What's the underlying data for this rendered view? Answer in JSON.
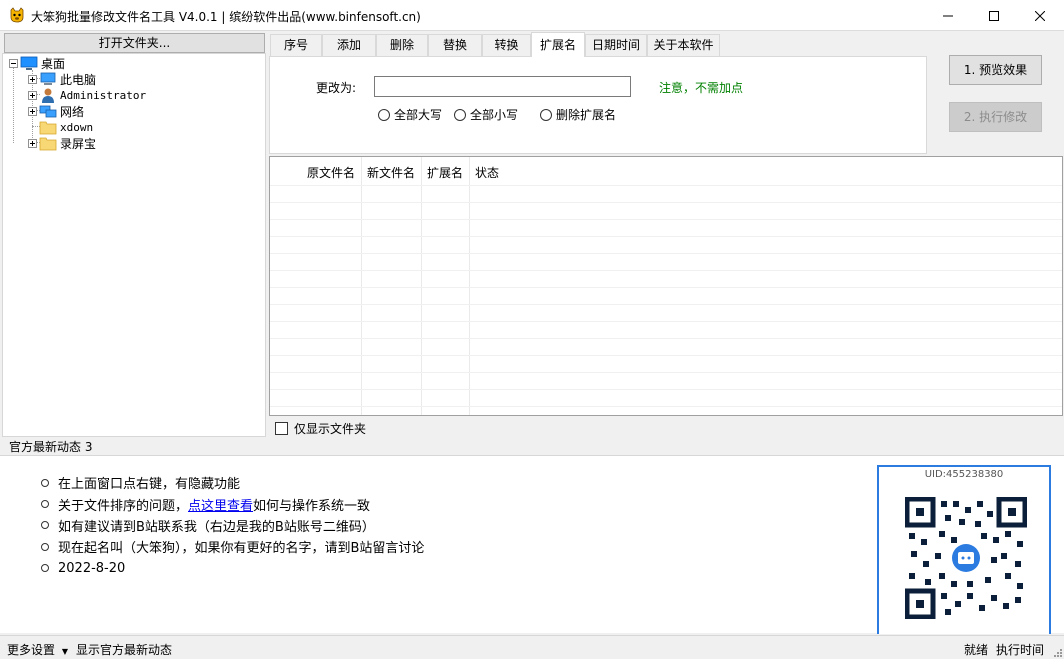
{
  "window": {
    "title": "大笨狗批量修改文件名工具 V4.0.1 | 缤纷软件出品(www.binfensoft.cn)"
  },
  "left_pane": {
    "open_folder_label": "打开文件夹...",
    "tree": {
      "root": "桌面",
      "items": [
        "此电脑",
        "Administrator",
        "网络",
        "xdown",
        "录屏宝"
      ]
    }
  },
  "tabs": [
    "序号",
    "添加",
    "删除",
    "替换",
    "转换",
    "扩展名",
    "日期时间",
    "关于本软件"
  ],
  "active_tab": "扩展名",
  "ext_panel": {
    "change_label": "更改为:",
    "input_value": "",
    "note": "注意，不需加点",
    "options": [
      "全部大写",
      "全部小写",
      "删除扩展名"
    ]
  },
  "buttons": {
    "preview": "1. 预览效果",
    "execute": "2. 执行修改"
  },
  "grid": {
    "columns": [
      "原文件名",
      "新文件名",
      "扩展名",
      "状态"
    ],
    "rows": []
  },
  "only_folders_label": "仅显示文件夹",
  "news": {
    "header": "官方最新动态  3",
    "items": [
      {
        "text": "在上面窗口点右键，有隐藏功能"
      },
      {
        "before": "关于文件排序的问题，",
        "link": "点这里查看",
        "after": "如何与操作系统一致"
      },
      {
        "text": "如有建议请到B站联系我（右边是我的B站账号二维码）"
      },
      {
        "text": "现在起名叫（大笨狗），如果你有更好的名字，请到B站留言讨论"
      },
      {
        "text": "2022-8-20"
      }
    ],
    "qr_uid": "UID:455238380"
  },
  "statusbar": {
    "more_settings": "更多设置",
    "show_news": "显示官方最新动态",
    "status": "就绪",
    "exec_time": "执行时间"
  },
  "colors": {
    "accent": "#2b7be0",
    "note_green": "#008000",
    "link": "#0000ee"
  }
}
